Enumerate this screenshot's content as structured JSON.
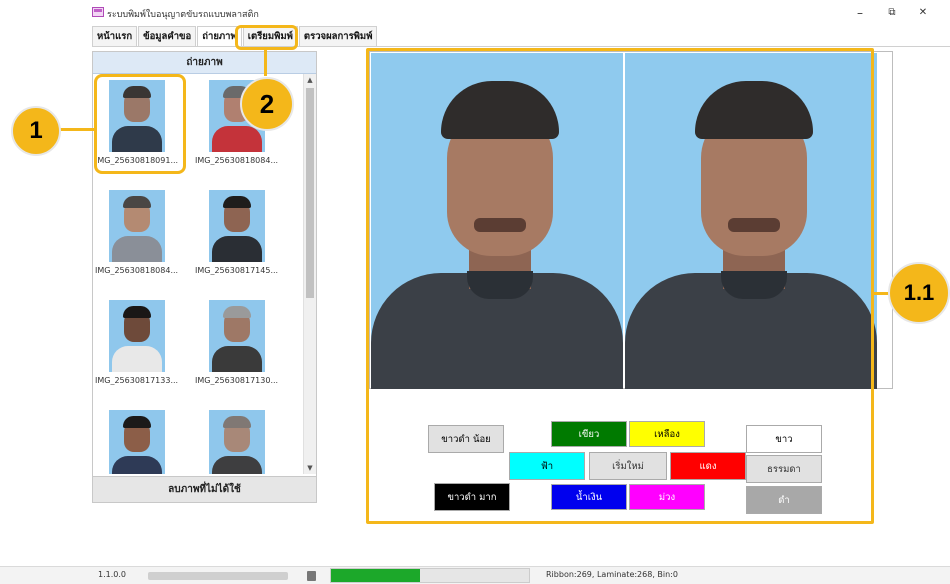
{
  "window": {
    "title": "ระบบพิมพ์ใบอนุญาตขับรถแบบพลาสติก",
    "minimize_glyph": "–",
    "restore_glyph": "⧉",
    "close_glyph": "✕"
  },
  "tabs": [
    {
      "label": "หน้าแรก"
    },
    {
      "label": "ข้อมูลคำขอ"
    },
    {
      "label": "ถ่ายภาพ"
    },
    {
      "label": "เตรียมพิมพ์"
    },
    {
      "label": "ตรวจผลการพิมพ์"
    }
  ],
  "left_panel": {
    "header": "ถ่ายภาพ",
    "delete_button": "ลบภาพที่ไม่ได้ใช้",
    "scroll_up_glyph": "▲",
    "scroll_down_glyph": "▼",
    "thumbnails": [
      {
        "caption": "IMG_25630818091..."
      },
      {
        "caption": "IMG_25630818084..."
      },
      {
        "caption": "IMG_25630818084..."
      },
      {
        "caption": "IMG_25630817145..."
      },
      {
        "caption": "IMG_25630817133..."
      },
      {
        "caption": "IMG_25630817130..."
      },
      {
        "caption": ""
      },
      {
        "caption": ""
      }
    ]
  },
  "annotations": {
    "badge_1": "1",
    "badge_2": "2",
    "badge_1_1": "1.1",
    "color": "#f4b71a"
  },
  "controls": {
    "bw_less": "ขาวดำ น้อย",
    "bw_more": "ขาวดำ มาก",
    "green": "เขียว",
    "yellow": "เหลือง",
    "cyan": "ฟ้า",
    "reset": "เริ่มใหม่",
    "red": "แดง",
    "blue": "น้ำเงิน",
    "purple": "ม่วง",
    "white": "ขาว",
    "normal": "ธรรมดา",
    "black": "ดำ"
  },
  "status_bar": {
    "version": "1.1.0.0",
    "progress_fraction": 0.45,
    "ribbon_info": "Ribbon:269, Laminate:268, Bin:0"
  },
  "colors": {
    "green_btn": "#007a00",
    "yellow_btn": "#ffff00",
    "cyan_btn": "#00ffff",
    "red_btn": "#ff0000",
    "blue_btn": "#0000ee",
    "magenta_btn": "#ff00ff",
    "black_btn": "#000000",
    "progress": "#1ca82a"
  }
}
